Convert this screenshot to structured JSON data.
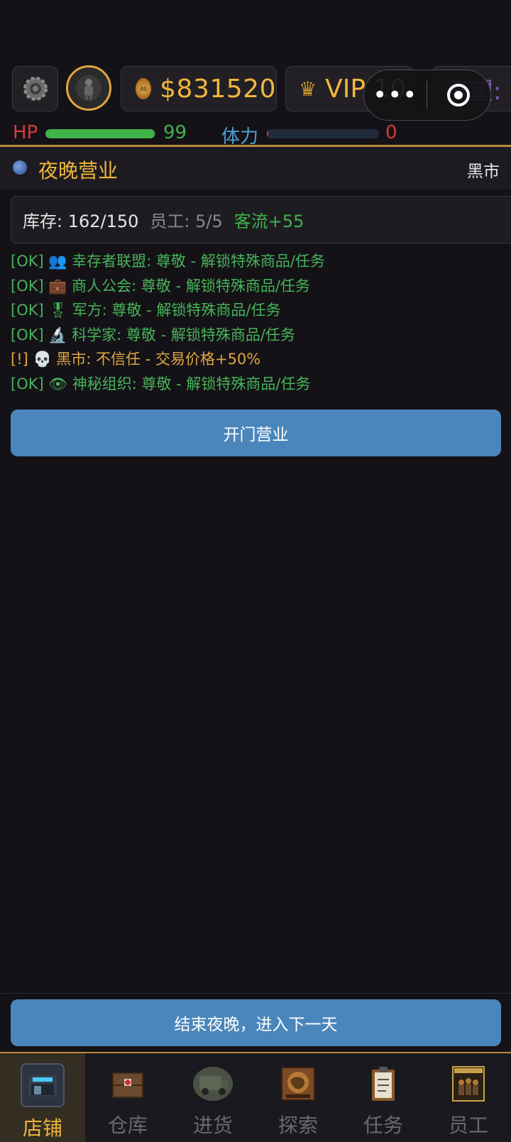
{
  "header": {
    "money": "$831520",
    "vip": "VIP 10",
    "fame": "声望:",
    "gear_icon": "gear-icon",
    "avatar_icon": "soldier-avatar-icon",
    "capsule_more": "•••",
    "colors": {
      "gold": "#f0b63d",
      "hp": "#d23c3c",
      "hp_bar": "#3fb24a",
      "stamina": "#4aa0d8",
      "accent_line": "#b9893a"
    }
  },
  "status": {
    "hp_label": "HP",
    "hp_value": "99",
    "hp_fraction": 0.99,
    "stamina_label": "体力",
    "stamina_value": "0",
    "stamina_fraction": 0.0
  },
  "section": {
    "title": "夜晚营业",
    "right_label": "黑市"
  },
  "info": {
    "inventory": "库存: 162/150",
    "employees": "员工: 5/5",
    "traffic": "客流+55"
  },
  "factions": [
    {
      "text": "[OK] 👥 幸存者联盟: 尊敬 - 解锁特殊商品/任务",
      "status": "ok"
    },
    {
      "text": "[OK] 💼 商人公会: 尊敬 - 解锁特殊商品/任务",
      "status": "ok"
    },
    {
      "text": "[OK] 🎖 军方: 尊敬 - 解锁特殊商品/任务",
      "status": "ok"
    },
    {
      "text": "[OK] 🔬 科学家: 尊敬 - 解锁特殊商品/任务",
      "status": "ok"
    },
    {
      "text": "[!] 💀 黑市: 不信任 - 交易价格+50%",
      "status": "warn"
    },
    {
      "text": "[OK] 👁 神秘组织: 尊敬 - 解锁特殊商品/任务",
      "status": "ok"
    }
  ],
  "actions": {
    "open_business": "开门营业",
    "end_night": "结束夜晚，进入下一天"
  },
  "tabs": [
    {
      "label": "店铺",
      "icon": "shop-icon",
      "active": true
    },
    {
      "label": "仓库",
      "icon": "warehouse-crate-icon",
      "active": false
    },
    {
      "label": "进货",
      "icon": "truck-icon",
      "active": false
    },
    {
      "label": "探索",
      "icon": "map-icon",
      "active": false
    },
    {
      "label": "任务",
      "icon": "clipboard-icon",
      "active": false
    },
    {
      "label": "员工",
      "icon": "team-poster-icon",
      "active": false
    }
  ]
}
